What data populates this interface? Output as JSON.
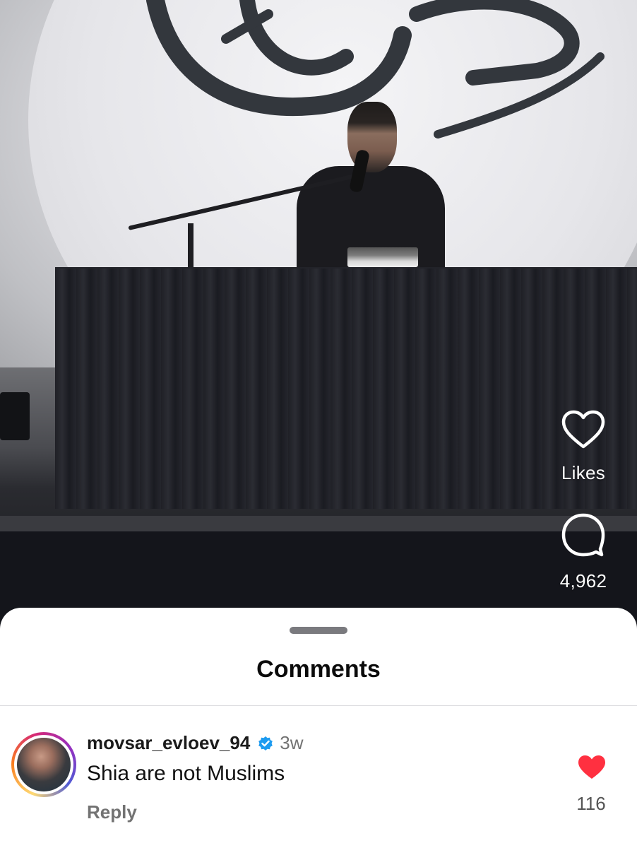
{
  "video": {
    "actions": {
      "likes_label": "Likes",
      "comments_count": "4,962"
    },
    "icons": {
      "like": "heart-outline-icon",
      "comment": "comment-bubble-icon"
    }
  },
  "comments_sheet": {
    "title": "Comments",
    "items": [
      {
        "username": "movsar_evloev_94",
        "verified": true,
        "time": "3w",
        "text": "Shia are not Muslims",
        "reply_label": "Reply",
        "likes": "116",
        "liked": true
      }
    ]
  },
  "colors": {
    "like_red": "#ff3040",
    "verified_blue": "#1d9bf0",
    "muted_text": "#737373"
  }
}
